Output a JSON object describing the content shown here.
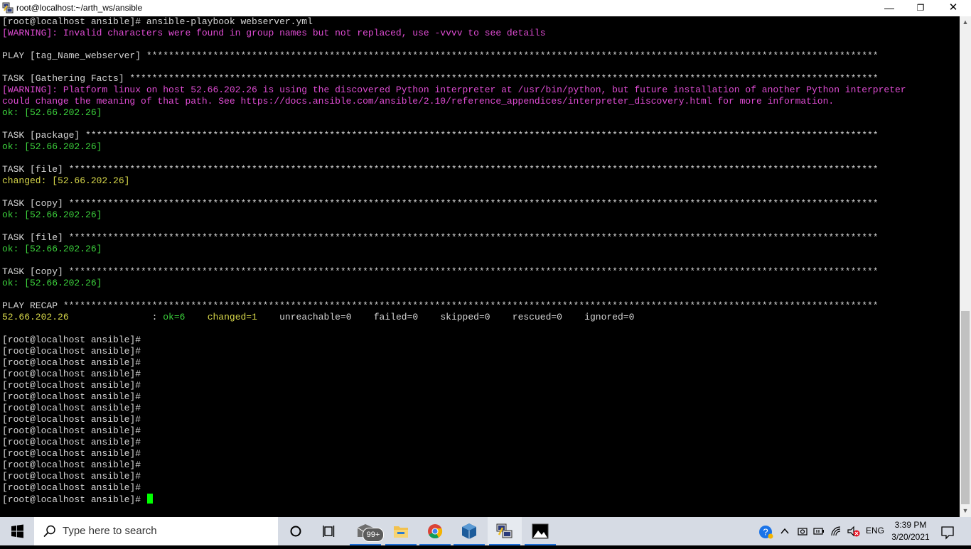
{
  "window": {
    "title": "root@localhost:~/arth_ws/ansible",
    "minimize_glyph": "—",
    "maximize_glyph": "❐",
    "close_glyph": "✕"
  },
  "terminal": {
    "lines": [
      [
        {
          "t": "[root@localhost ansible]# ansible-playbook webserver.yml",
          "c": "w"
        }
      ],
      [
        {
          "t": "[WARNING]: Invalid characters were found in group names but not replaced, use -vvvv to see details",
          "c": "m"
        }
      ],
      [
        {
          "t": "",
          "c": "w"
        }
      ],
      [
        {
          "t": "PLAY [tag_Name_webserver] ************************************************************************************************************************************",
          "c": "w"
        }
      ],
      [
        {
          "t": "",
          "c": "w"
        }
      ],
      [
        {
          "t": "TASK [Gathering Facts] ***************************************************************************************************************************************",
          "c": "w"
        }
      ],
      [
        {
          "t": "[WARNING]: Platform linux on host 52.66.202.26 is using the discovered Python interpreter at /usr/bin/python, but future installation of another Python interpreter",
          "c": "m"
        }
      ],
      [
        {
          "t": "could change the meaning of that path. See https://docs.ansible.com/ansible/2.10/reference_appendices/interpreter_discovery.html for more information.",
          "c": "m"
        }
      ],
      [
        {
          "t": "ok: [52.66.202.26]",
          "c": "g"
        }
      ],
      [
        {
          "t": "",
          "c": "w"
        }
      ],
      [
        {
          "t": "TASK [package] ***********************************************************************************************************************************************",
          "c": "w"
        }
      ],
      [
        {
          "t": "ok: [52.66.202.26]",
          "c": "g"
        }
      ],
      [
        {
          "t": "",
          "c": "w"
        }
      ],
      [
        {
          "t": "TASK [file] **************************************************************************************************************************************************",
          "c": "w"
        }
      ],
      [
        {
          "t": "changed: [52.66.202.26]",
          "c": "y"
        }
      ],
      [
        {
          "t": "",
          "c": "w"
        }
      ],
      [
        {
          "t": "TASK [copy] **************************************************************************************************************************************************",
          "c": "w"
        }
      ],
      [
        {
          "t": "ok: [52.66.202.26]",
          "c": "g"
        }
      ],
      [
        {
          "t": "",
          "c": "w"
        }
      ],
      [
        {
          "t": "TASK [file] **************************************************************************************************************************************************",
          "c": "w"
        }
      ],
      [
        {
          "t": "ok: [52.66.202.26]",
          "c": "g"
        }
      ],
      [
        {
          "t": "",
          "c": "w"
        }
      ],
      [
        {
          "t": "TASK [copy] **************************************************************************************************************************************************",
          "c": "w"
        }
      ],
      [
        {
          "t": "ok: [52.66.202.26]",
          "c": "g"
        }
      ],
      [
        {
          "t": "",
          "c": "w"
        }
      ],
      [
        {
          "t": "PLAY RECAP ***************************************************************************************************************************************************",
          "c": "w"
        }
      ],
      [
        {
          "t": "52.66.202.26",
          "c": "y"
        },
        {
          "t": "               : ",
          "c": "w"
        },
        {
          "t": "ok=6",
          "c": "g"
        },
        {
          "t": "    ",
          "c": "w"
        },
        {
          "t": "changed=1",
          "c": "y"
        },
        {
          "t": "    unreachable=0    failed=0    skipped=0    rescued=0    ignored=0",
          "c": "w"
        }
      ],
      [
        {
          "t": "",
          "c": "w"
        }
      ],
      [
        {
          "t": "[root@localhost ansible]#",
          "c": "w"
        }
      ],
      [
        {
          "t": "[root@localhost ansible]#",
          "c": "w"
        }
      ],
      [
        {
          "t": "[root@localhost ansible]#",
          "c": "w"
        }
      ],
      [
        {
          "t": "[root@localhost ansible]#",
          "c": "w"
        }
      ],
      [
        {
          "t": "[root@localhost ansible]#",
          "c": "w"
        }
      ],
      [
        {
          "t": "[root@localhost ansible]#",
          "c": "w"
        }
      ],
      [
        {
          "t": "[root@localhost ansible]#",
          "c": "w"
        }
      ],
      [
        {
          "t": "[root@localhost ansible]#",
          "c": "w"
        }
      ],
      [
        {
          "t": "[root@localhost ansible]#",
          "c": "w"
        }
      ],
      [
        {
          "t": "[root@localhost ansible]#",
          "c": "w"
        }
      ],
      [
        {
          "t": "[root@localhost ansible]#",
          "c": "w"
        }
      ],
      [
        {
          "t": "[root@localhost ansible]#",
          "c": "w"
        }
      ],
      [
        {
          "t": "[root@localhost ansible]#",
          "c": "w"
        }
      ],
      [
        {
          "t": "[root@localhost ansible]#",
          "c": "w"
        }
      ],
      [
        {
          "t": "[root@localhost ansible]# ",
          "c": "w"
        }
      ]
    ],
    "colors": {
      "ok": "#3cd23c",
      "changed": "#d8d84a",
      "warning": "#e04cd4",
      "text": "#d6d6d6",
      "cursor": "#00ff00"
    }
  },
  "taskbar": {
    "search_placeholder": "Type here to search",
    "mail_badge": "99+",
    "language": "ENG",
    "time": "3:39 PM",
    "date": "3/20/2021",
    "icons": [
      "windows-start-icon",
      "search-icon",
      "cortana-icon",
      "task-view-icon",
      "mail-icon",
      "file-explorer-icon",
      "chrome-icon",
      "virtualbox-icon",
      "putty-icon",
      "photos-icon"
    ]
  }
}
